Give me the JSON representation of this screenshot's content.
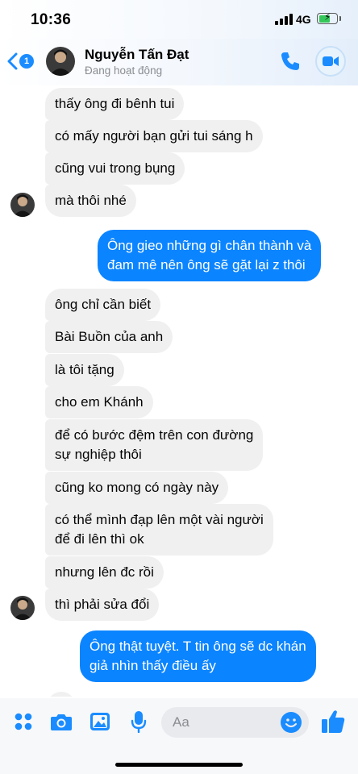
{
  "status_bar": {
    "time": "10:36",
    "network": "4G"
  },
  "header": {
    "back_count": "1",
    "contact_name": "Nguyễn Tấn Đạt",
    "contact_status": "Đang hoạt động"
  },
  "messages": [
    {
      "from": "them",
      "lines": [
        "thấy ông đi bênh tui"
      ]
    },
    {
      "from": "them",
      "lines": [
        "có mấy người bạn gửi tui sáng h"
      ]
    },
    {
      "from": "them",
      "lines": [
        "cũng vui trong bụng"
      ]
    },
    {
      "from": "them",
      "lines": [
        "mà thôi nhé"
      ]
    },
    {
      "from": "me",
      "lines": [
        "Ông gieo những gì chân thành và",
        "đam mê nên ông sẽ gặt lại z thôi"
      ]
    },
    {
      "from": "them",
      "lines": [
        "ông chỉ cần biết"
      ]
    },
    {
      "from": "them",
      "lines": [
        "Bài Buồn của anh"
      ]
    },
    {
      "from": "them",
      "lines": [
        "là tôi tặng"
      ]
    },
    {
      "from": "them",
      "lines": [
        "cho em Khánh"
      ]
    },
    {
      "from": "them",
      "lines": [
        "để có bước đệm trên con đường",
        "sự nghiệp thôi"
      ]
    },
    {
      "from": "them",
      "lines": [
        "cũng ko mong có ngày này"
      ]
    },
    {
      "from": "them",
      "lines": [
        "có thể mình đạp lên một vài người",
        "để đi lên thì ok"
      ]
    },
    {
      "from": "them",
      "lines": [
        "nhưng lên đc rồi"
      ]
    },
    {
      "from": "them",
      "lines": [
        "thì phải sửa đổi"
      ]
    },
    {
      "from": "me",
      "lines": [
        "Ông thật tuyệt. T tin ông sẽ dc khán",
        "giả nhìn thấy điều ấy"
      ]
    }
  ],
  "composer": {
    "placeholder": "Aa"
  },
  "icons": {
    "back": "chevron-left-icon",
    "call": "phone-icon",
    "video": "video-camera-icon",
    "menu": "four-dots-icon",
    "camera": "camera-icon",
    "gallery": "image-icon",
    "mic": "microphone-icon",
    "emoji": "smiley-icon",
    "like": "thumbs-up-icon"
  },
  "colors": {
    "accent": "#0b84ff",
    "incoming_bubble": "#f0f0f0",
    "badge": "#1a8cff"
  }
}
